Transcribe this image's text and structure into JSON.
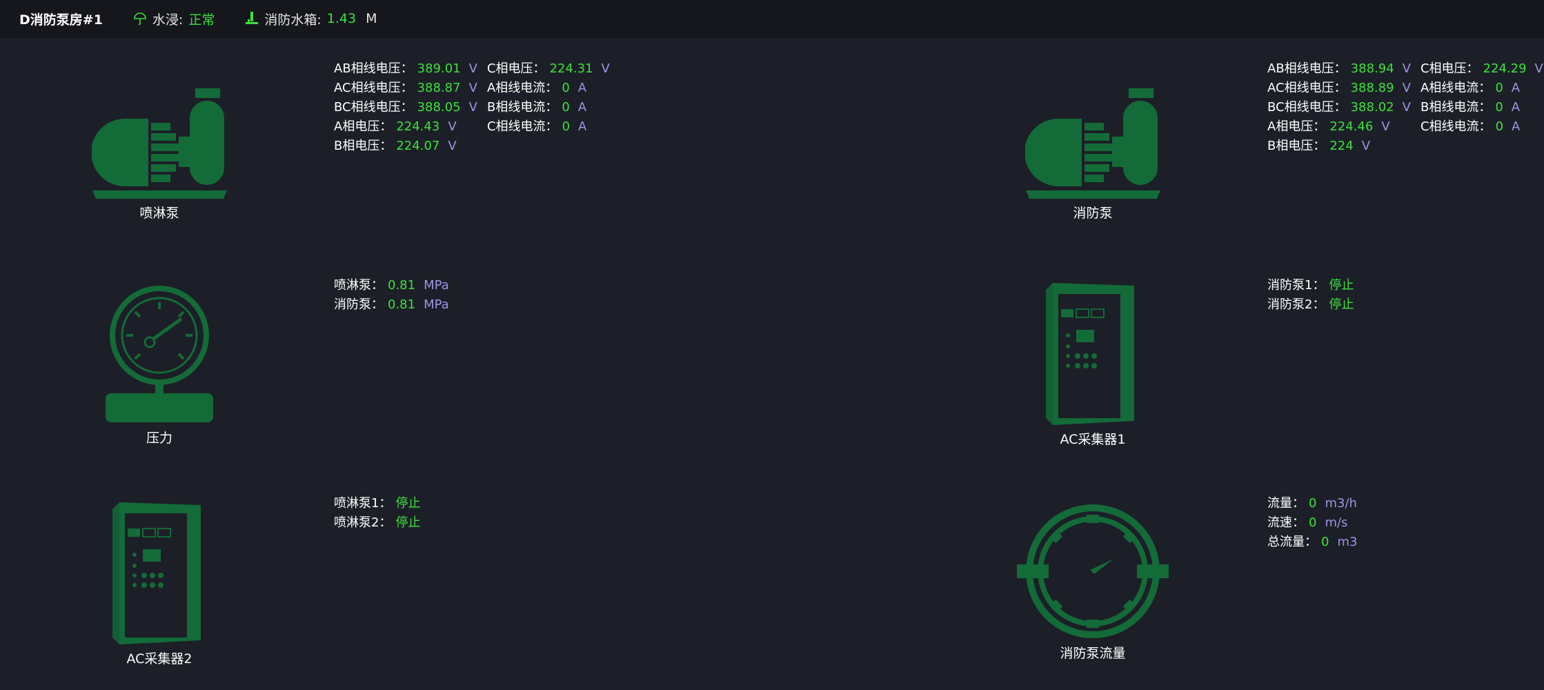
{
  "header": {
    "title": "D消防泵房#1",
    "water": {
      "label": "水浸:",
      "value": "正常"
    },
    "tank": {
      "label": "消防水箱:",
      "value": "1.43",
      "unit": "M"
    }
  },
  "devices": {
    "sprinkler_pump": "喷淋泵",
    "fire_pump": "消防泵",
    "pressure": "压力",
    "ac1": "AC采集器1",
    "ac2": "AC采集器2",
    "flow": "消防泵流量"
  },
  "sprinkler_elec": {
    "col1": [
      {
        "k": "AB相线电压：",
        "v": "389.01",
        "u": "V"
      },
      {
        "k": "AC相线电压：",
        "v": "388.87",
        "u": "V"
      },
      {
        "k": "BC相线电压：",
        "v": "388.05",
        "u": "V"
      },
      {
        "k": "A相电压：",
        "v": "224.43",
        "u": "V"
      },
      {
        "k": "B相电压：",
        "v": "224.07",
        "u": "V"
      }
    ],
    "col2": [
      {
        "k": "C相电压：",
        "v": "224.31",
        "u": "V"
      },
      {
        "k": "A相线电流：",
        "v": "0",
        "u": "A"
      },
      {
        "k": "B相线电流：",
        "v": "0",
        "u": "A"
      },
      {
        "k": "C相线电流：",
        "v": "0",
        "u": "A"
      }
    ]
  },
  "fire_elec": {
    "col1": [
      {
        "k": "AB相线电压：",
        "v": "388.94",
        "u": "V"
      },
      {
        "k": "AC相线电压：",
        "v": "388.89",
        "u": "V"
      },
      {
        "k": "BC相线电压：",
        "v": "388.02",
        "u": "V"
      },
      {
        "k": "A相电压：",
        "v": "224.46",
        "u": "V"
      },
      {
        "k": "B相电压：",
        "v": "224",
        "u": "V"
      }
    ],
    "col2": [
      {
        "k": "C相电压：",
        "v": "224.29",
        "u": "V"
      },
      {
        "k": "A相线电流：",
        "v": "0",
        "u": "A"
      },
      {
        "k": "B相线电流：",
        "v": "0",
        "u": "A"
      },
      {
        "k": "C相线电流：",
        "v": "0",
        "u": "A"
      }
    ]
  },
  "pressure_info": [
    {
      "k": "喷淋泵：",
      "v": "0.81",
      "u": "MPa"
    },
    {
      "k": "消防泵：",
      "v": "0.81",
      "u": "MPa"
    }
  ],
  "ac1_info": [
    {
      "k": "消防泵1：",
      "v": "停止"
    },
    {
      "k": "消防泵2：",
      "v": "停止"
    }
  ],
  "ac2_info": [
    {
      "k": "喷淋泵1：",
      "v": "停止"
    },
    {
      "k": "喷淋泵2：",
      "v": "停止"
    }
  ],
  "flow_info": [
    {
      "k": "流量：",
      "v": "0",
      "u": "m3/h"
    },
    {
      "k": "流速：",
      "v": "0",
      "u": "m/s"
    },
    {
      "k": "总流量：",
      "v": "0",
      "u": "m3"
    }
  ],
  "colors": {
    "icon": "#136b38",
    "value": "#3be23b",
    "unit": "#9c95e6"
  },
  "icons": [
    "umbrella-icon",
    "water-level-icon",
    "pump-icon",
    "pressure-gauge-icon",
    "cabinet-icon",
    "flow-meter-icon"
  ]
}
